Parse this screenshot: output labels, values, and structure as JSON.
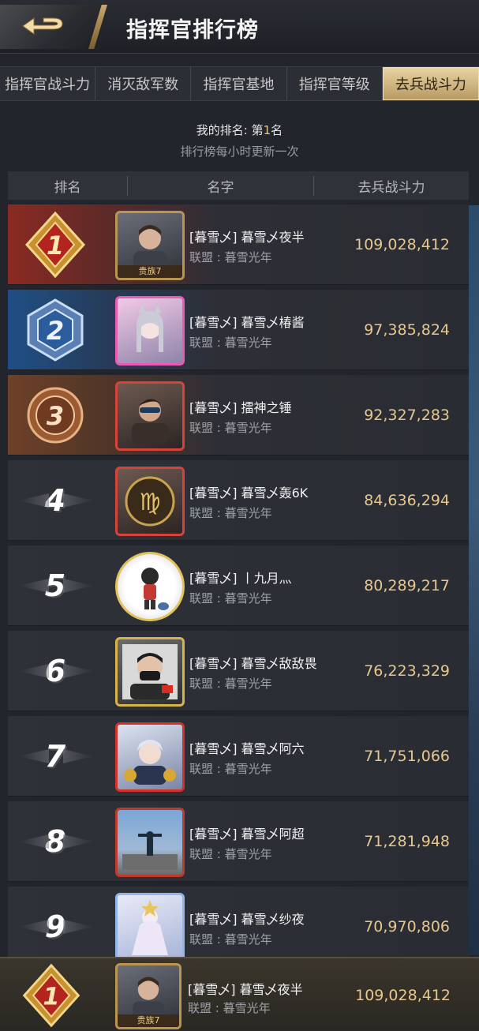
{
  "header": {
    "title": "指挥官排行榜"
  },
  "tabs": [
    {
      "label": "指挥官战斗力",
      "active": false
    },
    {
      "label": "消灭敌军数",
      "active": false
    },
    {
      "label": "指挥官基地",
      "active": false
    },
    {
      "label": "指挥官等级",
      "active": false
    },
    {
      "label": "去兵战斗力",
      "active": true
    }
  ],
  "my_rank": {
    "prefix": "我的排名: 第",
    "number": "1",
    "suffix": "名",
    "update_note": "排行榜每小时更新一次"
  },
  "columns": {
    "rank": "排名",
    "name": "名字",
    "power": "去兵战斗力"
  },
  "rows": [
    {
      "rank": "1",
      "name": "[暮雪乄] 暮雪乄夜半",
      "alliance": "联盟 : 暮雪光年",
      "power": "109,028,412",
      "avatar_tag": "贵族7"
    },
    {
      "rank": "2",
      "name": "[暮雪乄] 暮雪乄椿酱",
      "alliance": "联盟 : 暮雪光年",
      "power": "97,385,824"
    },
    {
      "rank": "3",
      "name": "[暮雪乄] 擂神之锤",
      "alliance": "联盟 : 暮雪光年",
      "power": "92,327,283"
    },
    {
      "rank": "4",
      "name": "[暮雪乄] 暮雪乄轰6K",
      "alliance": "联盟 : 暮雪光年",
      "power": "84,636,294"
    },
    {
      "rank": "5",
      "name": "[暮雪乄] 丨九月灬",
      "alliance": "联盟 : 暮雪光年",
      "power": "80,289,217"
    },
    {
      "rank": "6",
      "name": "[暮雪乄] 暮雪乄敌敌畏",
      "alliance": "联盟 : 暮雪光年",
      "power": "76,223,329"
    },
    {
      "rank": "7",
      "name": "[暮雪乄] 暮雪乄阿六",
      "alliance": "联盟 : 暮雪光年",
      "power": "71,751,066"
    },
    {
      "rank": "8",
      "name": "[暮雪乄] 暮雪乄阿超",
      "alliance": "联盟 : 暮雪光年",
      "power": "71,281,948"
    },
    {
      "rank": "9",
      "name": "[暮雪乄] 暮雪乄纱夜",
      "alliance": "联盟 : 暮雪光年",
      "power": "70,970,806"
    }
  ],
  "my_entry": {
    "rank": "1",
    "name": "[暮雪乄] 暮雪乄夜半",
    "alliance": "联盟 : 暮雪光年",
    "power": "109,028,412",
    "avatar_tag": "贵族7"
  },
  "colors": {
    "gold": "#e7c88c",
    "rank1": "#8a2a22",
    "rank2": "#1f4f86",
    "rank3": "#6e4128",
    "active_tab": "#e8d3a4"
  }
}
